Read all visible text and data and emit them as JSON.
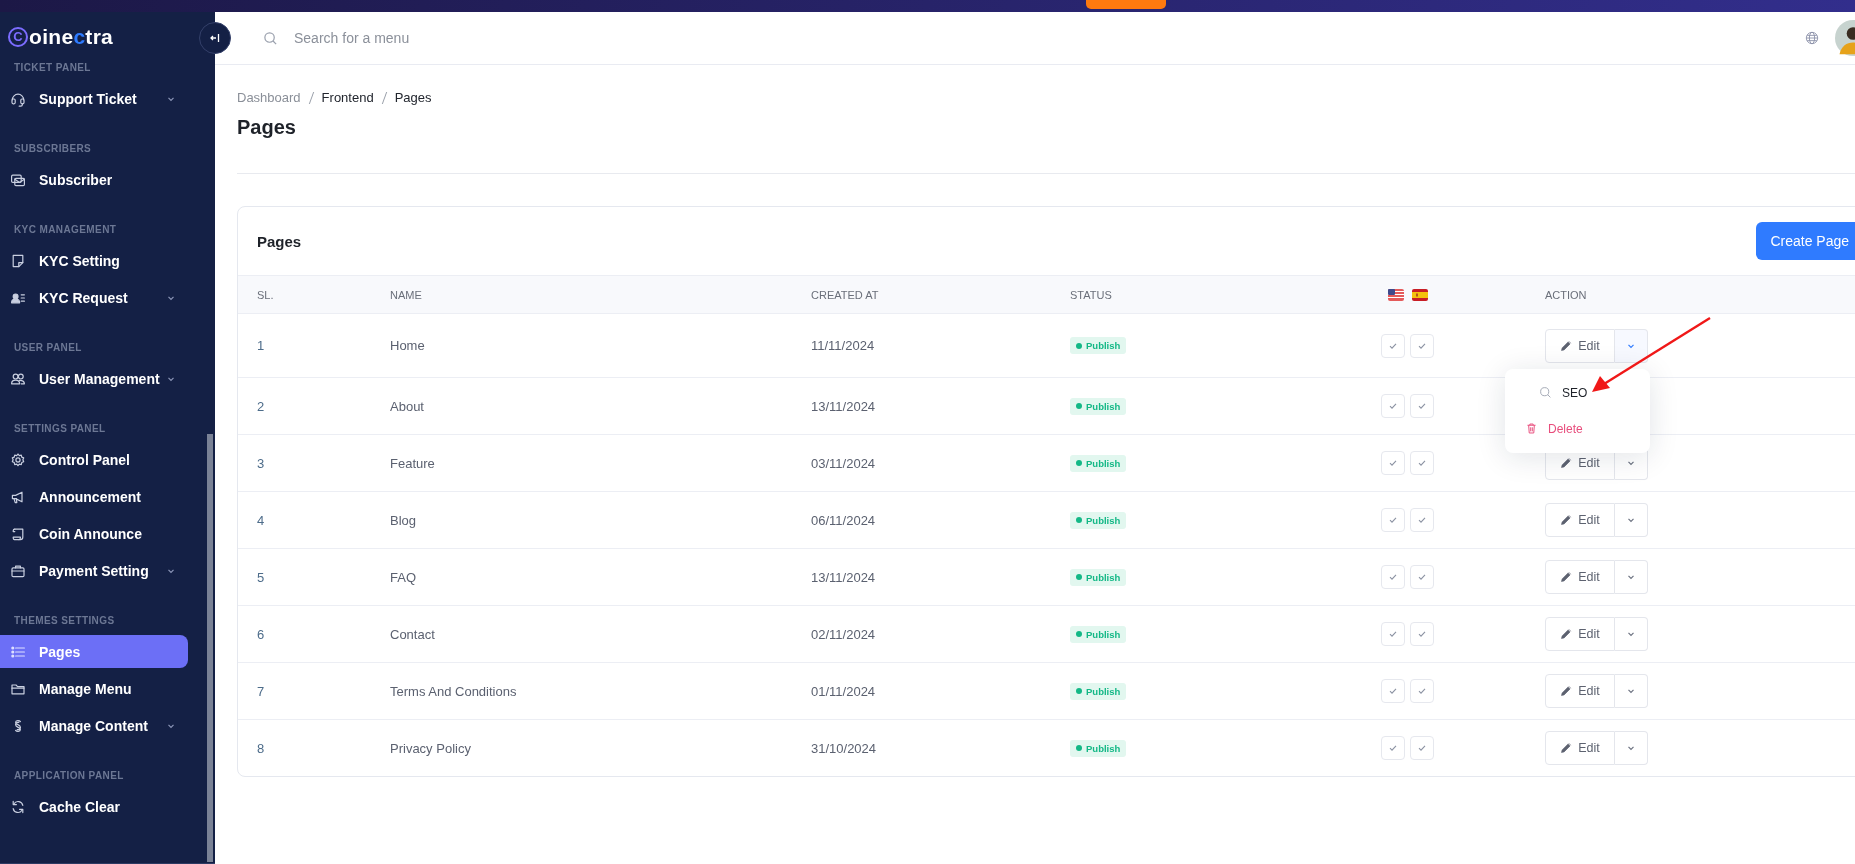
{
  "logo": [
    {
      "text": "C",
      "kind": "ring"
    },
    {
      "text": "oine",
      "kind": "plain"
    },
    {
      "text": "c",
      "kind": "accent"
    },
    {
      "text": "tra",
      "kind": "plain"
    }
  ],
  "sidebar": {
    "sections": [
      {
        "title": "TICKET PANEL",
        "items": [
          {
            "label": "Support Ticket",
            "has_submenu": true,
            "selected": false
          }
        ]
      },
      {
        "title": "SUBSCRIBERS",
        "items": [
          {
            "label": "Subscriber",
            "has_submenu": false,
            "selected": false
          }
        ]
      },
      {
        "title": "KYC MANAGEMENT",
        "items": [
          {
            "label": "KYC Setting",
            "has_submenu": false,
            "selected": false
          },
          {
            "label": "KYC Request",
            "has_submenu": true,
            "selected": false
          }
        ]
      },
      {
        "title": "USER PANEL",
        "items": [
          {
            "label": "User Management",
            "has_submenu": true,
            "selected": false
          }
        ]
      },
      {
        "title": "SETTINGS PANEL",
        "items": [
          {
            "label": "Control Panel",
            "has_submenu": false,
            "selected": false
          },
          {
            "label": "Announcement",
            "has_submenu": false,
            "selected": false
          },
          {
            "label": "Coin Announce",
            "has_submenu": false,
            "selected": false
          },
          {
            "label": "Payment Setting",
            "has_submenu": true,
            "selected": false
          }
        ]
      },
      {
        "title": "THEMES SETTINGS",
        "items": [
          {
            "label": "Pages",
            "has_submenu": false,
            "selected": true
          },
          {
            "label": "Manage Menu",
            "has_submenu": false,
            "selected": false
          },
          {
            "label": "Manage Content",
            "has_submenu": true,
            "selected": false
          }
        ]
      },
      {
        "title": "APPLICATION PANEL",
        "items": [
          {
            "label": "Cache Clear",
            "has_submenu": false,
            "selected": false
          }
        ]
      }
    ]
  },
  "search": {
    "placeholder": "Search for a menu"
  },
  "breadcrumb": [
    {
      "label": "Dashboard",
      "current": false
    },
    {
      "label": "Frontend",
      "current": true
    },
    {
      "label": "Pages",
      "current": true
    }
  ],
  "page_title": "Pages",
  "card": {
    "title": "Pages",
    "create_button": "Create Page",
    "columns": [
      {
        "label": "SL.",
        "kind": "text"
      },
      {
        "label": "NAME",
        "kind": "text"
      },
      {
        "label": "CREATED AT",
        "kind": "text"
      },
      {
        "label": "STATUS",
        "kind": "text"
      },
      {
        "kind": "flags"
      },
      {
        "label": "ACTION",
        "kind": "text"
      }
    ],
    "rows": [
      {
        "sl": "1",
        "name": "Home",
        "created_at": "11/11/2024",
        "status": "Publish",
        "checks": [
          {
            "checked": true
          },
          {
            "checked": true
          }
        ],
        "edit": "Edit",
        "menu_open": true
      },
      {
        "sl": "2",
        "name": "About",
        "created_at": "13/11/2024",
        "status": "Publish",
        "checks": [
          {
            "checked": true
          },
          {
            "checked": true
          }
        ]
      },
      {
        "sl": "3",
        "name": "Feature",
        "created_at": "03/11/2024",
        "status": "Publish",
        "checks": [
          {
            "checked": true
          },
          {
            "checked": true
          }
        ],
        "edit": "Edit",
        "menu_open": false
      },
      {
        "sl": "4",
        "name": "Blog",
        "created_at": "06/11/2024",
        "status": "Publish",
        "checks": [
          {
            "checked": true
          },
          {
            "checked": true
          }
        ],
        "edit": "Edit",
        "menu_open": false
      },
      {
        "sl": "5",
        "name": "FAQ",
        "created_at": "13/11/2024",
        "status": "Publish",
        "checks": [
          {
            "checked": true
          },
          {
            "checked": true
          }
        ],
        "edit": "Edit",
        "menu_open": false
      },
      {
        "sl": "6",
        "name": "Contact",
        "created_at": "02/11/2024",
        "status": "Publish",
        "checks": [
          {
            "checked": true
          },
          {
            "checked": true
          }
        ],
        "edit": "Edit",
        "menu_open": false
      },
      {
        "sl": "7",
        "name": "Terms And Conditions",
        "created_at": "01/11/2024",
        "status": "Publish",
        "checks": [
          {
            "checked": true
          },
          {
            "checked": true
          }
        ],
        "edit": "Edit",
        "menu_open": false
      },
      {
        "sl": "8",
        "name": "Privacy Policy",
        "created_at": "31/10/2024",
        "status": "Publish",
        "checks": [
          {
            "checked": true
          },
          {
            "checked": true
          }
        ],
        "edit": "Edit",
        "menu_open": false
      }
    ]
  },
  "row_menu": [
    {
      "label": "SEO",
      "kind": "search"
    },
    {
      "label": "Delete",
      "kind": "danger"
    }
  ]
}
